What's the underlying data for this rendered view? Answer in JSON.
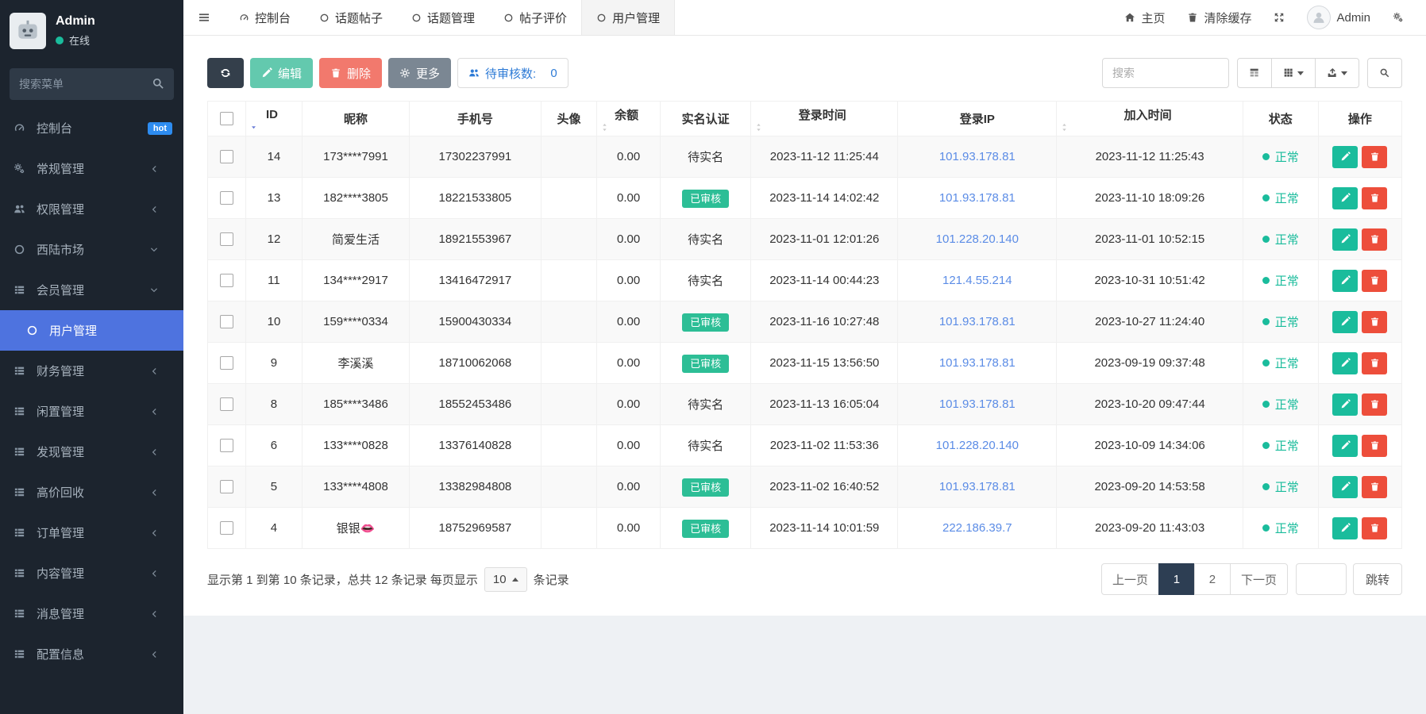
{
  "colors": {
    "primary": "#4e73df",
    "success": "#1abc9c",
    "danger": "#ed4e3b",
    "link": "#5b8ce6",
    "hot_badge": "#2d8cf0"
  },
  "topbar": {
    "tabs": [
      {
        "key": "dashboard",
        "icon": "tachometer",
        "label": "控制台",
        "active": false
      },
      {
        "key": "topic-post",
        "icon": "circle-o",
        "label": "话题帖子",
        "active": false
      },
      {
        "key": "topic",
        "icon": "circle-o",
        "label": "话题管理",
        "active": false
      },
      {
        "key": "post-review",
        "icon": "circle-o",
        "label": "帖子评价",
        "active": false
      },
      {
        "key": "user",
        "icon": "circle-o",
        "label": "用户管理",
        "active": true
      }
    ],
    "home_label": "主页",
    "clear_cache_label": "清除缓存",
    "admin_label": "Admin"
  },
  "sidebar": {
    "user": {
      "name": "Admin",
      "status_label": "在线"
    },
    "search_placeholder": "搜索菜单",
    "items": [
      {
        "key": "dashboard",
        "icon": "tachometer",
        "label": "控制台",
        "badge": "hot"
      },
      {
        "key": "general",
        "icon": "cogs",
        "label": "常规管理",
        "chevron": "left"
      },
      {
        "key": "auth",
        "icon": "users",
        "label": "权限管理",
        "chevron": "left"
      },
      {
        "key": "market",
        "icon": "circle-o",
        "label": "西陆市场",
        "chevron": "down"
      },
      {
        "key": "member",
        "icon": "list",
        "label": "会员管理",
        "chevron": "down"
      },
      {
        "key": "user",
        "icon": "circle-o",
        "label": "用户管理",
        "sub": true,
        "active": true
      },
      {
        "key": "finance",
        "icon": "list",
        "label": "财务管理",
        "chevron": "left"
      },
      {
        "key": "idle",
        "icon": "list",
        "label": "闲置管理",
        "chevron": "left"
      },
      {
        "key": "discover",
        "icon": "list",
        "label": "发现管理",
        "chevron": "left"
      },
      {
        "key": "recycle",
        "icon": "list",
        "label": "高价回收",
        "chevron": "left"
      },
      {
        "key": "order",
        "icon": "list",
        "label": "订单管理",
        "chevron": "left"
      },
      {
        "key": "content",
        "icon": "list",
        "label": "内容管理",
        "chevron": "left"
      },
      {
        "key": "message",
        "icon": "list",
        "label": "消息管理",
        "chevron": "left"
      },
      {
        "key": "config",
        "icon": "list",
        "label": "配置信息",
        "chevron": "left"
      }
    ]
  },
  "toolbar": {
    "edit_label": "编辑",
    "delete_label": "删除",
    "more_label": "更多",
    "pending_label": "待审核数:",
    "pending_count": "0",
    "search_placeholder": "搜索"
  },
  "table": {
    "columns": [
      {
        "label": "ID",
        "sort": "desc"
      },
      {
        "label": "昵称",
        "sort": "none"
      },
      {
        "label": "手机号",
        "sort": "none"
      },
      {
        "label": "头像",
        "sort": "none"
      },
      {
        "label": "余额",
        "sort": "both"
      },
      {
        "label": "实名认证",
        "sort": "none"
      },
      {
        "label": "登录时间",
        "sort": "both"
      },
      {
        "label": "登录IP",
        "sort": "none"
      },
      {
        "label": "加入时间",
        "sort": "both"
      },
      {
        "label": "状态",
        "sort": "none"
      },
      {
        "label": "操作",
        "sort": "none"
      }
    ],
    "verified_badge_label": "已审核",
    "unverified_label": "待实名",
    "status_normal_label": "正常",
    "rows": [
      {
        "id": "14",
        "nickname": "173****7991",
        "phone": "17302237991",
        "avatar": "",
        "balance": "0.00",
        "verified": false,
        "login_time": "2023-11-12 11:25:44",
        "login_ip": "101.93.178.81",
        "join_time": "2023-11-12 11:25:43",
        "status": "正常"
      },
      {
        "id": "13",
        "nickname": "182****3805",
        "phone": "18221533805",
        "avatar": "",
        "balance": "0.00",
        "verified": true,
        "login_time": "2023-11-14 14:02:42",
        "login_ip": "101.93.178.81",
        "join_time": "2023-11-10 18:09:26",
        "status": "正常"
      },
      {
        "id": "12",
        "nickname": "简爱生活",
        "phone": "18921553967",
        "avatar": "",
        "balance": "0.00",
        "verified": false,
        "login_time": "2023-11-01 12:01:26",
        "login_ip": "101.228.20.140",
        "join_time": "2023-11-01 10:52:15",
        "status": "正常"
      },
      {
        "id": "11",
        "nickname": "134****2917",
        "phone": "13416472917",
        "avatar": "",
        "balance": "0.00",
        "verified": false,
        "login_time": "2023-11-14 00:44:23",
        "login_ip": "121.4.55.214",
        "join_time": "2023-10-31 10:51:42",
        "status": "正常"
      },
      {
        "id": "10",
        "nickname": "159****0334",
        "phone": "15900430334",
        "avatar": "",
        "balance": "0.00",
        "verified": true,
        "login_time": "2023-11-16 10:27:48",
        "login_ip": "101.93.178.81",
        "join_time": "2023-10-27 11:24:40",
        "status": "正常"
      },
      {
        "id": "9",
        "nickname": "李溪溪",
        "phone": "18710062068",
        "avatar": "",
        "balance": "0.00",
        "verified": true,
        "login_time": "2023-11-15 13:56:50",
        "login_ip": "101.93.178.81",
        "join_time": "2023-09-19 09:37:48",
        "status": "正常"
      },
      {
        "id": "8",
        "nickname": "185****3486",
        "phone": "18552453486",
        "avatar": "",
        "balance": "0.00",
        "verified": false,
        "login_time": "2023-11-13 16:05:04",
        "login_ip": "101.93.178.81",
        "join_time": "2023-10-20 09:47:44",
        "status": "正常"
      },
      {
        "id": "6",
        "nickname": "133****0828",
        "phone": "13376140828",
        "avatar": "",
        "balance": "0.00",
        "verified": false,
        "login_time": "2023-11-02 11:53:36",
        "login_ip": "101.228.20.140",
        "join_time": "2023-10-09 14:34:06",
        "status": "正常"
      },
      {
        "id": "5",
        "nickname": "133****4808",
        "phone": "13382984808",
        "avatar": "",
        "balance": "0.00",
        "verified": true,
        "login_time": "2023-11-02 16:40:52",
        "login_ip": "101.93.178.81",
        "join_time": "2023-09-20 14:53:58",
        "status": "正常"
      },
      {
        "id": "4",
        "nickname": "银银👄",
        "phone": "18752969587",
        "avatar": "",
        "balance": "0.00",
        "verified": true,
        "login_time": "2023-11-14 10:01:59",
        "login_ip": "222.186.39.7",
        "join_time": "2023-09-20 11:43:03",
        "status": "正常"
      }
    ]
  },
  "pagination": {
    "summary_prefix": "显示第 1 到第 10 条记录，总共 12 条记录 每页显示",
    "page_size": "10",
    "summary_suffix": "条记录",
    "prev_label": "上一页",
    "pages": [
      "1",
      "2"
    ],
    "active_page": "1",
    "next_label": "下一页",
    "jump_label": "跳转"
  }
}
